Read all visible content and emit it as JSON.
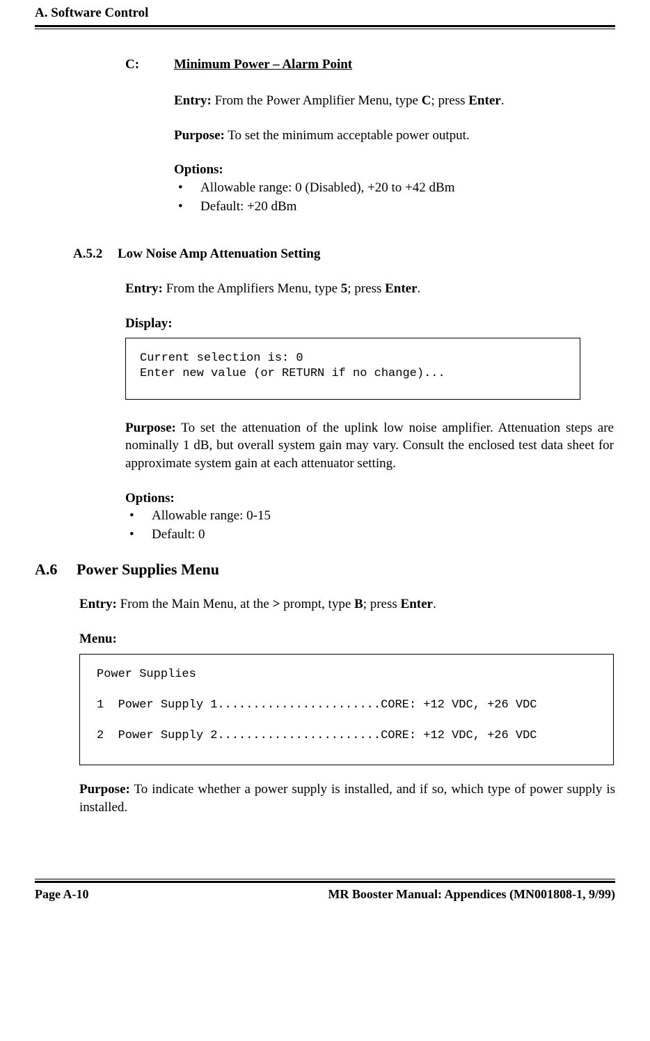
{
  "header": {
    "title": "A. Software Control"
  },
  "sectionC": {
    "prefix": "C:",
    "title": "Minimum Power – Alarm Point",
    "entry": {
      "label": "Entry:",
      "text1": " From the Power Amplifier Menu, type ",
      "key": "C",
      "text2": "; press ",
      "enter": "Enter",
      "text3": "."
    },
    "purpose": {
      "label": "Purpose:",
      "text": " To set the minimum acceptable power output."
    },
    "options": {
      "label": "Options:",
      "items": [
        "Allowable range: 0 (Disabled), +20 to +42 dBm",
        "Default: +20 dBm"
      ]
    }
  },
  "sectionA52": {
    "num": "A.5.2",
    "title": "Low Noise Amp Attenuation Setting",
    "entry": {
      "label": "Entry:",
      "text1": " From the Amplifiers Menu, type ",
      "key": "5",
      "text2": "; press ",
      "enter": "Enter",
      "text3": "."
    },
    "display": {
      "label": "Display:",
      "line1": "Current selection is: 0",
      "line2": "Enter new value (or RETURN if no change)..."
    },
    "purpose": {
      "label": "Purpose:",
      "text": " To set the attenuation of the uplink low noise amplifier. Attenuation steps are nominally 1 dB, but overall system gain may vary. Consult the enclosed test data sheet for approximate system gain at each attenuator setting."
    },
    "options": {
      "label": "Options:",
      "items": [
        "Allowable range: 0-15",
        "Default: 0"
      ]
    }
  },
  "sectionA6": {
    "num": "A.6",
    "title": "Power Supplies Menu",
    "entry": {
      "label": "Entry:",
      "text1": " From the Main Menu, at the ",
      "prompt": ">",
      "text2": " prompt, type ",
      "key": "B",
      "text3": "; press ",
      "enter": "Enter",
      "text4": "."
    },
    "menu": {
      "label": "Menu:",
      "line1": "Power Supplies",
      "line2": "1  Power Supply 1.......................CORE: +12 VDC, +26 VDC",
      "line3": "2  Power Supply 2.......................CORE: +12 VDC, +26 VDC"
    },
    "purpose": {
      "label": "Purpose:",
      "text": " To indicate whether a power supply is installed, and if so, which type of power supply is installed."
    }
  },
  "footer": {
    "left": "Page A-10",
    "right": "MR Booster Manual: Appendices (MN001808-1, 9/99)"
  }
}
